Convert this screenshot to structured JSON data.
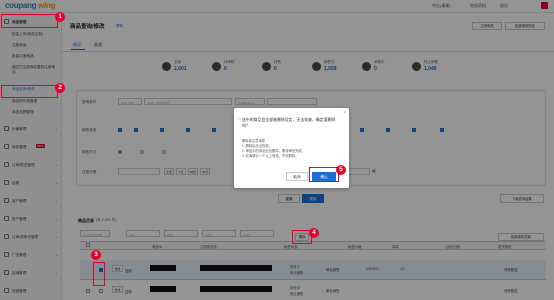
{
  "header": {
    "logo_part1": "coupang",
    "logo_part2": " wing",
    "vendor_label": "中仕(事業)",
    "status_label": "完成资料",
    "exit_label": "退出"
  },
  "sidebar": {
    "items": [
      {
        "label": "商品管理"
      },
      {
        "label": "批量上传(商品注册)"
      },
      {
        "label": "注册商品"
      },
      {
        "label": "批量注册商品"
      },
      {
        "label": "通过已注册商品复制注册商品"
      },
      {
        "label": "商品查询/修改"
      },
      {
        "label": "商品报价权管理"
      },
      {
        "label": "商品品牌管理"
      },
      {
        "label": "价格管理"
      },
      {
        "label": "库存管理"
      },
      {
        "label": "订单/配送管理"
      },
      {
        "label": "结算"
      },
      {
        "label": "客户管理"
      },
      {
        "label": "账户管理"
      },
      {
        "label": "订单/退换货管理"
      },
      {
        "label": "广告管理"
      },
      {
        "label": "店铺管理"
      },
      {
        "label": "促销管理"
      }
    ],
    "new_badge": "NEW"
  },
  "main": {
    "page_title": "商品查询/修改",
    "help_link": "帮助",
    "top_buttons": [
      "注册商品",
      "批量修改商品"
    ],
    "tabs": [
      "概况",
      "普通"
    ],
    "stats": [
      {
        "label": "全部",
        "value": "2,001"
      },
      {
        "label": "待审核",
        "value": "0"
      },
      {
        "label": "待售",
        "value": "0"
      },
      {
        "label": "销售中",
        "value": "1,059"
      },
      {
        "label": "审核中",
        "value": "0"
      },
      {
        "label": "停止销售",
        "value": "1,040"
      }
    ],
    "search_label": "搜索条件",
    "search_field": "商品名称",
    "search_placeholder": "请输入搜索内容",
    "id_field": "注册商品ID",
    "status_label": "销售状态",
    "sale_method_label": "销售方式",
    "date_label": "注册日期",
    "date_options": [
      "今天",
      "7日",
      "30日",
      "90日"
    ],
    "reset_button": "重置",
    "search_button": "搜索",
    "export_button": "下载查询结果",
    "list_title": "商品目录",
    "list_count": "(共 2,001 件)",
    "sort_label": "最近注册日期",
    "filters": [
      "全部",
      "全部",
      "全部",
      "全部"
    ],
    "delete_button": "删除",
    "batch_button": "批量修改/复制",
    "columns": [
      "",
      "商品ID",
      "注册商品名",
      "销售状态",
      "销售价格",
      "库存",
      "注册日期",
      "发货类型"
    ],
    "rows": [
      {
        "edit": "修改",
        "copy": "复制",
        "status": "销售中",
        "sale": "停止销售",
        "fee": "单品销售",
        "price": "145,870",
        "stock": "1/1",
        "type": "商家配送"
      },
      {
        "edit": "修改",
        "copy": "复制",
        "status": "销售中",
        "sale": "停止销售",
        "fee": "单品销售",
        "price": "",
        "stock": "",
        "type": "商家配送"
      }
    ]
  },
  "modal": {
    "title": "选中的商品会全部被删除设定，无法恢复，确定要删除吗？",
    "note_header": "删除前注意事项",
    "notes": [
      "1. 删除后无法恢复。",
      "2. 审批中的商品无法删除，需待审批完成。",
      "3. 在库单价一个以上商品，不可删除。"
    ],
    "cancel": "取消",
    "confirm": "确认"
  },
  "annotations": [
    "1",
    "2",
    "3",
    "4",
    "5"
  ]
}
